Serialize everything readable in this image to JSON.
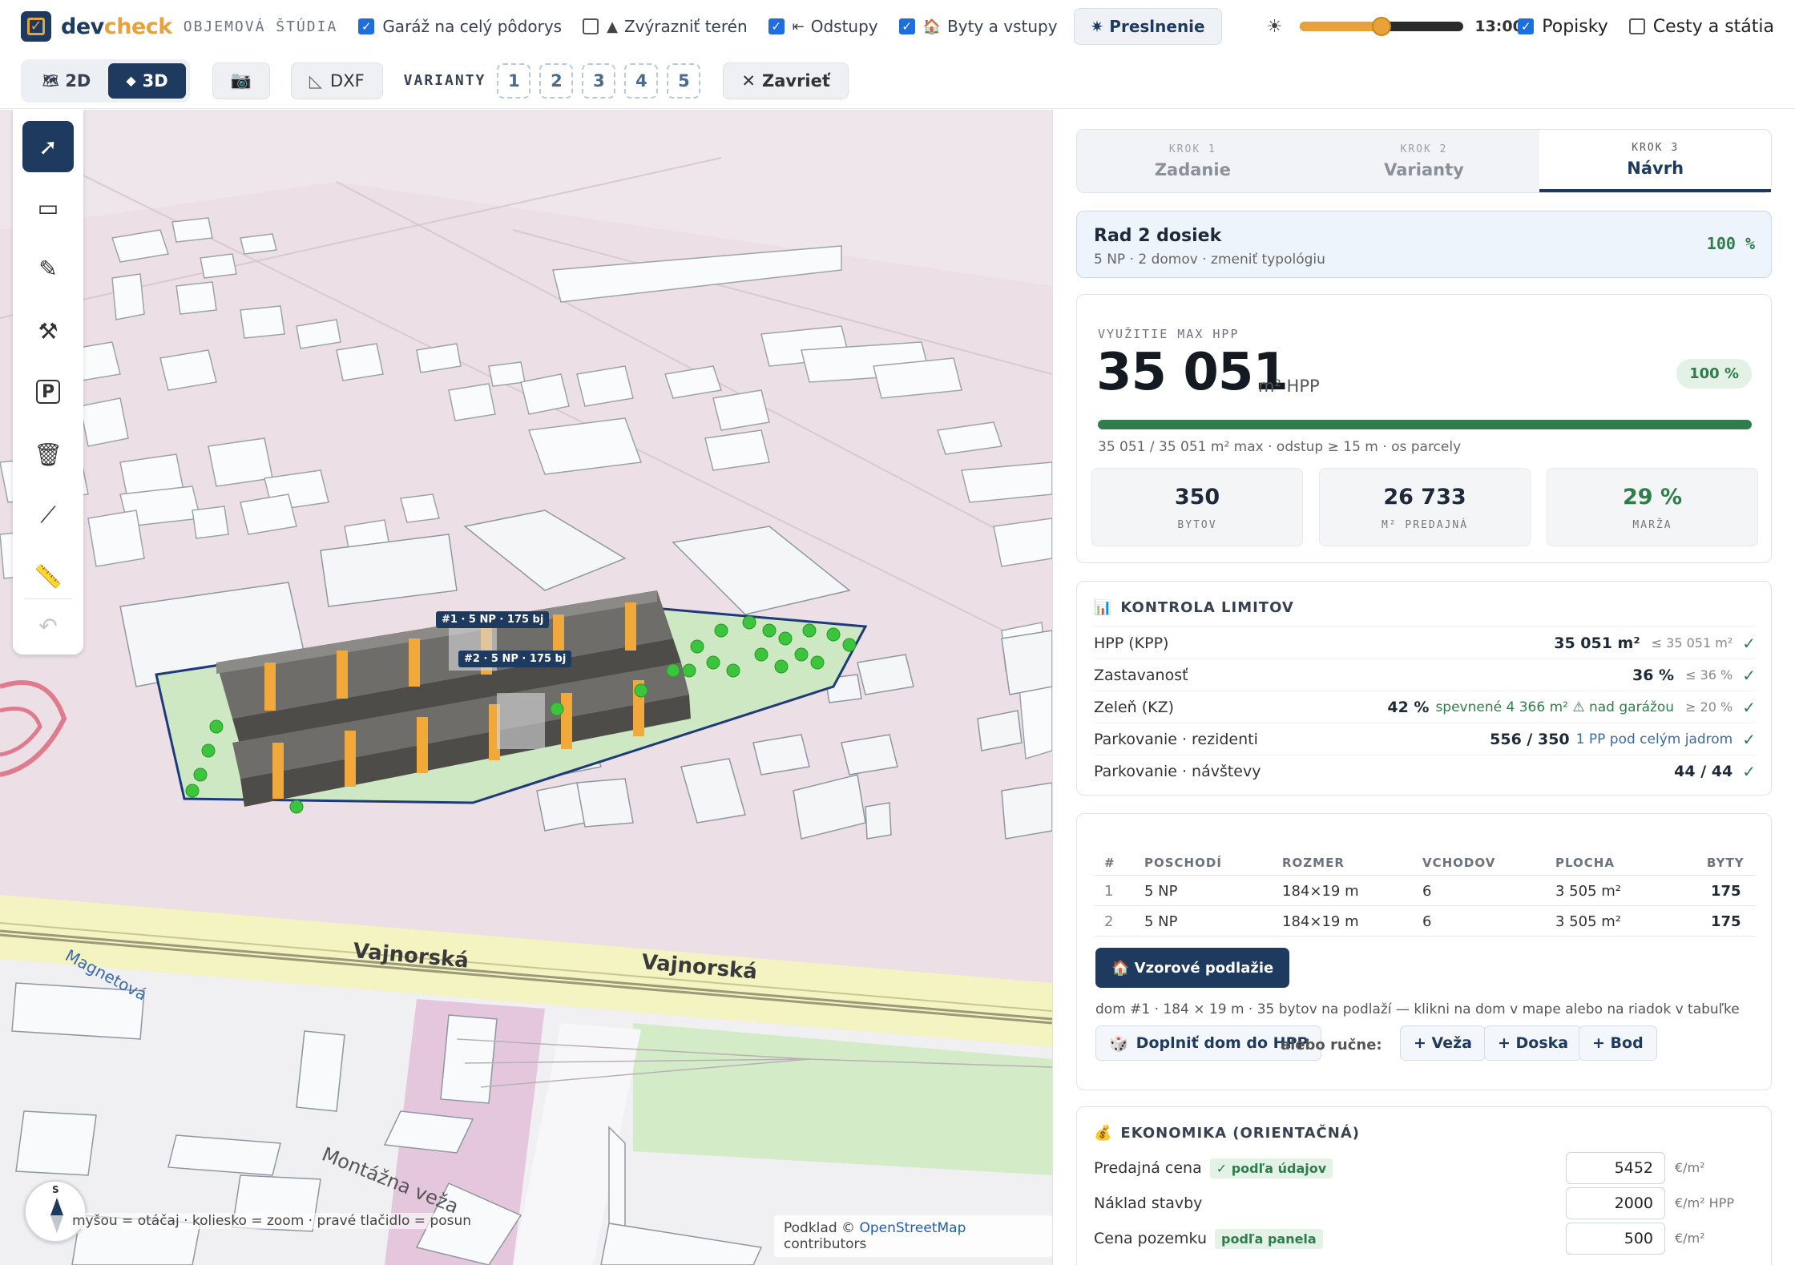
{
  "topbar": {
    "brand_a": "dev",
    "brand_b": "check",
    "subtitle": "OBJEMOVÁ ŠTÚDIA",
    "toggles": [
      {
        "label": "Garáž na celý pôdorys",
        "checked": true,
        "icon": ""
      },
      {
        "label": "Zvýrazniť terén",
        "checked": false,
        "icon": "▲"
      },
      {
        "label": "Odstupy",
        "checked": true,
        "icon": "⇤"
      },
      {
        "label": "Byty a vstupy",
        "checked": true,
        "icon": "🏠"
      }
    ],
    "presl_label": "✷ Preslnenie",
    "time": "13:00",
    "time_slider_fraction": 0.5,
    "labels_toggle": "Popisky",
    "roads_toggle": "Cesty a státia"
  },
  "bar2": {
    "view_2d": "2D",
    "view_3d": "3D",
    "dxf": "DXF",
    "variants_label": "VARIANTY",
    "variants": [
      "1",
      "2",
      "3",
      "4",
      "5"
    ],
    "close": "Zavrieť"
  },
  "map": {
    "building_labels": [
      "#1 · 5 NP · 175 bj",
      "#2 · 5 NP · 175 bj"
    ],
    "streets": [
      "Vajnorská",
      "Vajnorská",
      "Magnetová",
      "Montážna veža"
    ],
    "hint": "myšou = otáčaj · koliesko = zoom · pravé tlačidlo = posun",
    "attrib_prefix": "Podklad ©",
    "attrib_link": "OpenStreetMap",
    "attrib_suffix": "contributors",
    "compass_n": "S"
  },
  "steps": [
    {
      "k": "KROK 1",
      "n": "Zadanie"
    },
    {
      "k": "KROK 2",
      "n": "Varianty"
    },
    {
      "k": "KROK 3",
      "n": "Návrh"
    }
  ],
  "typology": {
    "title": "Rad 2 dosiek",
    "sub": "5 NP · 2 domov · zmeniť typológiu",
    "pct": "100 %"
  },
  "hpp": {
    "label": "VYUŽITIE MAX HPP",
    "value": "35 051",
    "unit": "m² HPP",
    "badge": "100 %",
    "progress_fraction": 1.0,
    "caption": "35 051 / 35 051 m² max · odstup ≥ 15 m · os parcely",
    "kpis": [
      {
        "v": "350",
        "l": "BYTOV"
      },
      {
        "v": "26 733",
        "l": "M² PREDAJNÁ"
      },
      {
        "v": "29 %",
        "l": "MARŽA"
      }
    ]
  },
  "limits": {
    "title": "KONTROLA LIMITOV",
    "rows": [
      {
        "label": "HPP (KPP)",
        "val": "35 051 m²",
        "note": "",
        "lim": "≤ 35 051 m²"
      },
      {
        "label": "Zastavanosť",
        "val": "36 %",
        "note": "",
        "lim": "≤ 36 %"
      },
      {
        "label": "Zeleň (KZ)",
        "val": "42 %",
        "note": "spevnené 4 366 m² ⚠ nad garážou",
        "lim": "≥ 20 %"
      },
      {
        "label": "Parkovanie · rezidenti",
        "val": "556 / 350",
        "note": "1 PP pod celým jadrom",
        "lim": ""
      },
      {
        "label": "Parkovanie · návštevy",
        "val": "44 / 44",
        "note": "",
        "lim": ""
      }
    ],
    "ok": "✓"
  },
  "table": {
    "headers": [
      "#",
      "POSCHODÍ",
      "ROZMER",
      "VCHODOV",
      "PLOCHA",
      "BYTY"
    ],
    "rows": [
      [
        "1",
        "5 NP",
        "184×19 m",
        "6",
        "3 505 m²",
        "175"
      ],
      [
        "2",
        "5 NP",
        "184×19 m",
        "6",
        "3 505 m²",
        "175"
      ]
    ],
    "floor_btn": "🏠 Vzorové podlažie",
    "note": "dom #1 · 184 × 19 m · 35 bytov na podlaží — klikni na dom v mape alebo na riadok v tabuľke",
    "fill_btn": "Doplniť dom do HPP",
    "or_text": "alebo ručne:",
    "add_buttons": [
      "+ Veža",
      "+ Doska",
      "+ Bod"
    ]
  },
  "economy": {
    "title": "EKONOMIKA (ORIENTAČNÁ)",
    "rows": [
      {
        "label": "Predajná cena",
        "tag": "✓ podľa údajov",
        "value": "5452",
        "unit": "€/m²"
      },
      {
        "label": "Náklad stavby",
        "tag": "",
        "value": "2000",
        "unit": "€/m² HPP"
      },
      {
        "label": "Cena pozemku",
        "tag": "podľa panela",
        "value": "500",
        "unit": "€/m²"
      }
    ]
  },
  "colors": {
    "navy": "#1e3a5f",
    "accent": "#e8a23a",
    "green": "#2e7d4a"
  }
}
